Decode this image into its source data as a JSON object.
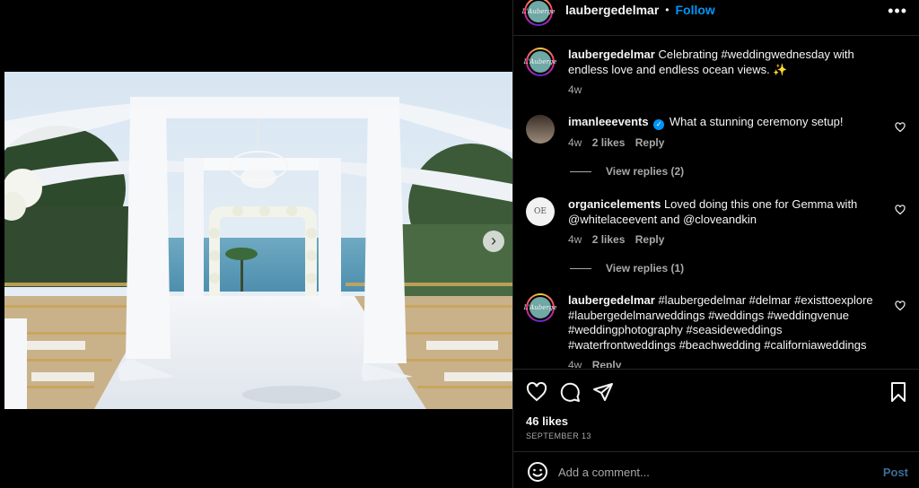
{
  "post": {
    "username": "laubergedelmar",
    "follow_label": "Follow",
    "separator": "•",
    "more_icon": "more-horizontal-icon",
    "avatar_text": "L'Auberge"
  },
  "caption": {
    "username": "laubergedelmar",
    "text": "Celebrating #weddingwednesday with endless love and endless ocean views. ✨",
    "time": "4w"
  },
  "comments": [
    {
      "username": "imanleeevents",
      "verified": true,
      "text": "What a stunning ceremony setup!",
      "time": "4w",
      "likes": "2 likes",
      "reply_label": "Reply",
      "view_replies": "View replies (2)"
    },
    {
      "username": "organicelements",
      "avatar_text": "OE",
      "text": "Loved doing this one for Gemma with @whitelaceevent and @cloveandkin",
      "time": "4w",
      "likes": "2 likes",
      "reply_label": "Reply",
      "view_replies": "View replies (1)"
    },
    {
      "username": "laubergedelmar",
      "avatar_text": "L'Auberge",
      "text": "#laubergedelmar #delmar #existtoexplore #laubergedelmarweddings #weddings #weddingvenue #weddingphotography #seasideweddings #waterfrontweddings #beachwedding #californiaweddings",
      "time": "4w",
      "reply_label": "Reply"
    }
  ],
  "actions": {
    "likes_count": "46 likes",
    "date": "SEPTEMBER 13"
  },
  "add_comment": {
    "placeholder": "Add a comment...",
    "post_label": "Post"
  },
  "colors": {
    "accent": "#0095f6",
    "background": "#000000",
    "secondary_text": "#a8a8a8",
    "divider": "#262626"
  }
}
